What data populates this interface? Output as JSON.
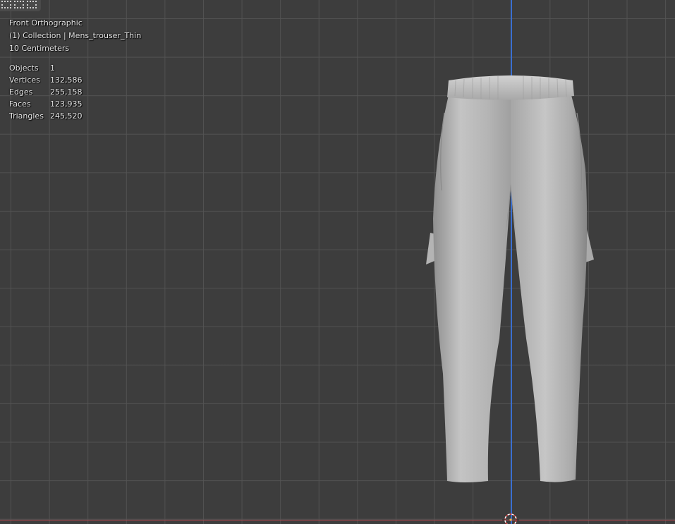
{
  "viewport": {
    "view_name": "Front Orthographic",
    "collection_info": "(1) Collection | Mens_trouser_Thin",
    "grid_scale": "10 Centimeters",
    "background_color": "#3d3d3d",
    "axis_colors": {
      "z": "#3a6fd0",
      "x": "#b5474f"
    }
  },
  "stats": {
    "rows": [
      {
        "label": "Objects",
        "value": "1"
      },
      {
        "label": "Vertices",
        "value": "132,586"
      },
      {
        "label": "Edges",
        "value": "255,158"
      },
      {
        "label": "Faces",
        "value": "123,935"
      },
      {
        "label": "Triangles",
        "value": "245,520"
      }
    ]
  },
  "icons": {
    "corner": [
      "object-mode-icon",
      "selection-mode-icon",
      "overlay-mode-icon"
    ],
    "cursor": "3d-cursor-icon"
  }
}
